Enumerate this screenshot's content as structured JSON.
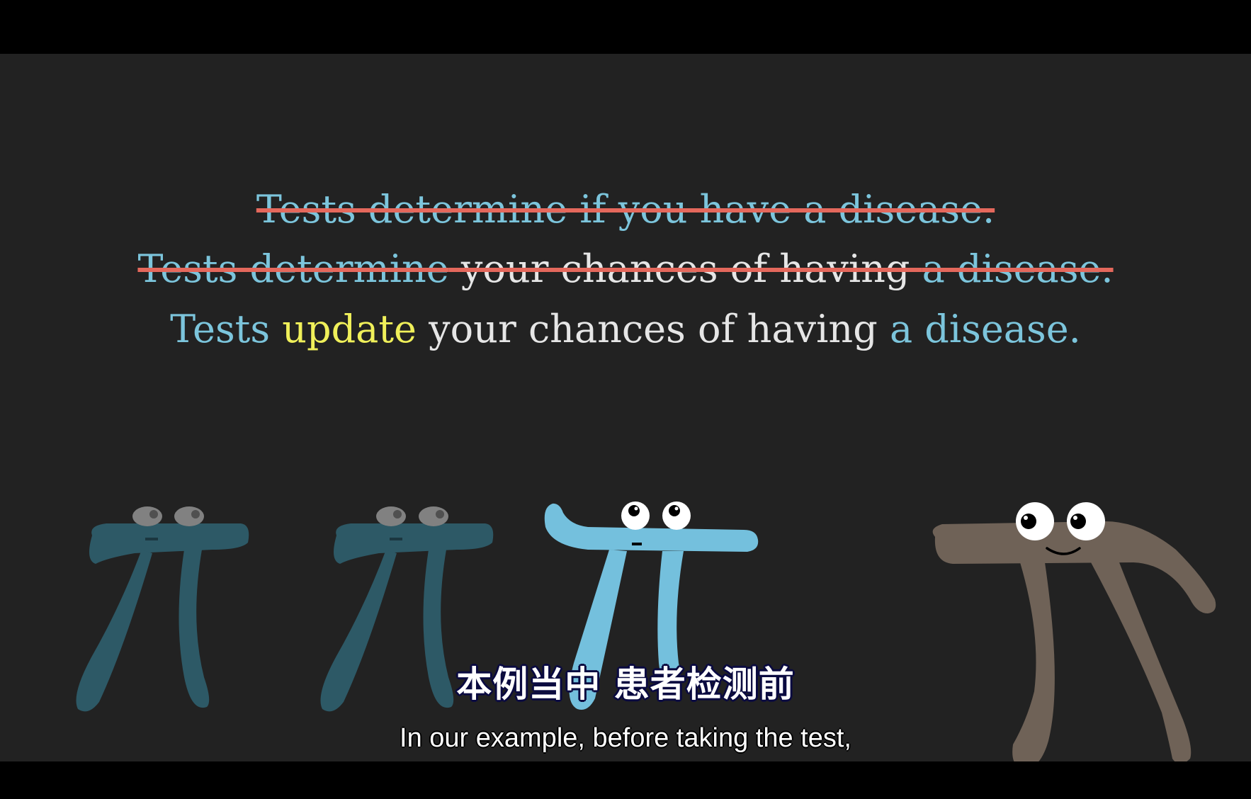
{
  "statements": {
    "line1": {
      "text": "Tests determine if you have a disease.",
      "struck": true
    },
    "line2": {
      "part1": "Tests determine",
      "part2": " your chances of having ",
      "part3": "a disease.",
      "struck": true
    },
    "line3": {
      "part1": "Tests ",
      "part2": "update",
      "part3": " your chances of having ",
      "part4": "a disease."
    }
  },
  "subtitles": {
    "chinese": "本例当中  患者检测前",
    "english": "In our example, before taking the test,"
  },
  "characters": [
    {
      "name": "pi-faded-1",
      "color": "#2f5f6e",
      "state": "faded"
    },
    {
      "name": "pi-faded-2",
      "color": "#2f5f6e",
      "state": "faded"
    },
    {
      "name": "pi-blue",
      "color": "#74c0dd",
      "state": "looking-up"
    },
    {
      "name": "pi-brown",
      "color": "#6f6257",
      "state": "smiling"
    }
  ],
  "colors": {
    "background": "#222222",
    "letterbox": "#000000",
    "blue_text": "#7cc5dc",
    "white_text": "#e6e6e6",
    "yellow_text": "#f0f05a",
    "strike": "#e4685c"
  }
}
